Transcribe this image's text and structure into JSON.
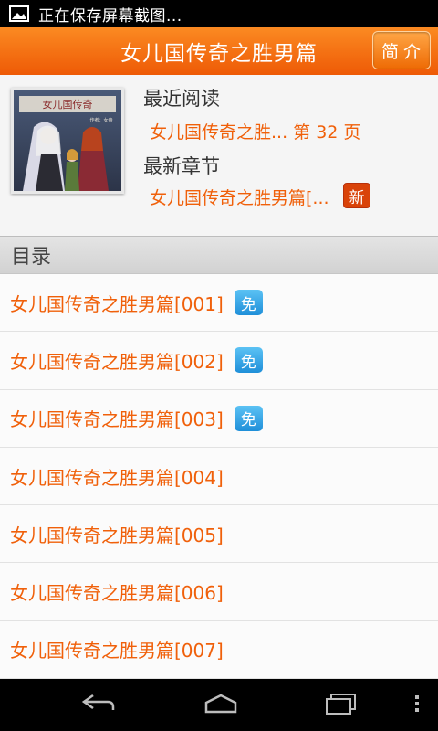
{
  "status_bar": {
    "text": "正在保存屏幕截图..."
  },
  "header": {
    "title": "女儿国传奇之胜男篇",
    "intro_button": "简介"
  },
  "book_info": {
    "recent_reading_label": "最近阅读",
    "recent_reading_value": "女儿国传奇之胜... 第 32 页",
    "latest_chapter_label": "最新章节",
    "latest_chapter_value": "女儿国传奇之胜男篇[...",
    "new_badge": "新",
    "cover_title": "女儿国传奇",
    "cover_author": "作者：女帝"
  },
  "catalog": {
    "header": "目录",
    "items": [
      {
        "title": "女儿国传奇之胜男篇[001]",
        "badge": "免"
      },
      {
        "title": "女儿国传奇之胜男篇[002]",
        "badge": "免"
      },
      {
        "title": "女儿国传奇之胜男篇[003]",
        "badge": "免"
      },
      {
        "title": "女儿国传奇之胜男篇[004]",
        "badge": ""
      },
      {
        "title": "女儿国传奇之胜男篇[005]",
        "badge": ""
      },
      {
        "title": "女儿国传奇之胜男篇[006]",
        "badge": ""
      },
      {
        "title": "女儿国传奇之胜男篇[007]",
        "badge": ""
      }
    ]
  },
  "colors": {
    "accent": "#f0600a",
    "title_bar": "#f57514",
    "free_badge": "#2a9ae0",
    "new_badge": "#d94309"
  },
  "nav": {
    "icons": [
      "back-icon",
      "home-icon",
      "recent-apps-icon",
      "menu-icon"
    ]
  }
}
